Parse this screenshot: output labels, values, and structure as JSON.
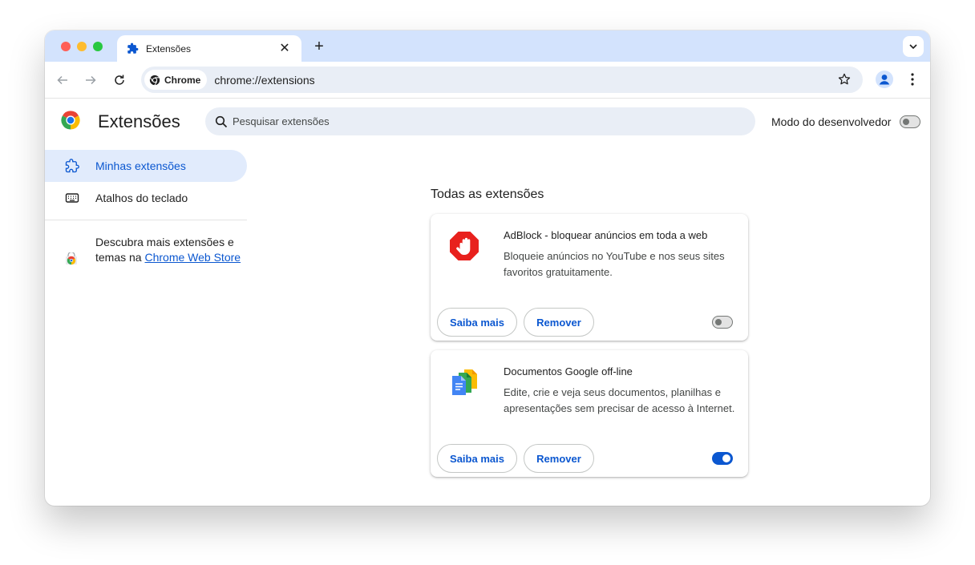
{
  "browser": {
    "tab_title": "Extensões",
    "chip_label": "Chrome",
    "url": "chrome://extensions"
  },
  "header": {
    "title": "Extensões",
    "search_placeholder": "Pesquisar extensões",
    "dev_mode_label": "Modo do desenvolvedor",
    "dev_mode_enabled": false
  },
  "sidebar": {
    "items": [
      {
        "label": "Minhas extensões",
        "icon": "puzzle-icon",
        "active": true
      },
      {
        "label": "Atalhos do teclado",
        "icon": "keyboard-icon",
        "active": false
      }
    ],
    "discover_prefix": "Descubra mais extensões e temas na ",
    "discover_link": "Chrome Web Store"
  },
  "main": {
    "section_title": "Todas as extensões",
    "extensions": [
      {
        "name": "AdBlock - bloquear anúncios em toda a web",
        "description": "Bloqueie anúncios no YouTube e nos seus sites favoritos gratuitamente.",
        "details_label": "Saiba mais",
        "remove_label": "Remover",
        "enabled": false,
        "icon": "adblock-hand-icon"
      },
      {
        "name": "Documentos Google off-line",
        "description": "Edite, crie e veja seus documentos, planilhas e apresentações sem precisar de acesso à Internet.",
        "details_label": "Saiba mais",
        "remove_label": "Remover",
        "enabled": true,
        "icon": "google-docs-icon"
      }
    ]
  },
  "colors": {
    "accent": "#0b57d0",
    "tabstrip": "#d3e3fd",
    "active_nav_bg": "#e1ebfc",
    "adblock_red": "#e8211d"
  }
}
